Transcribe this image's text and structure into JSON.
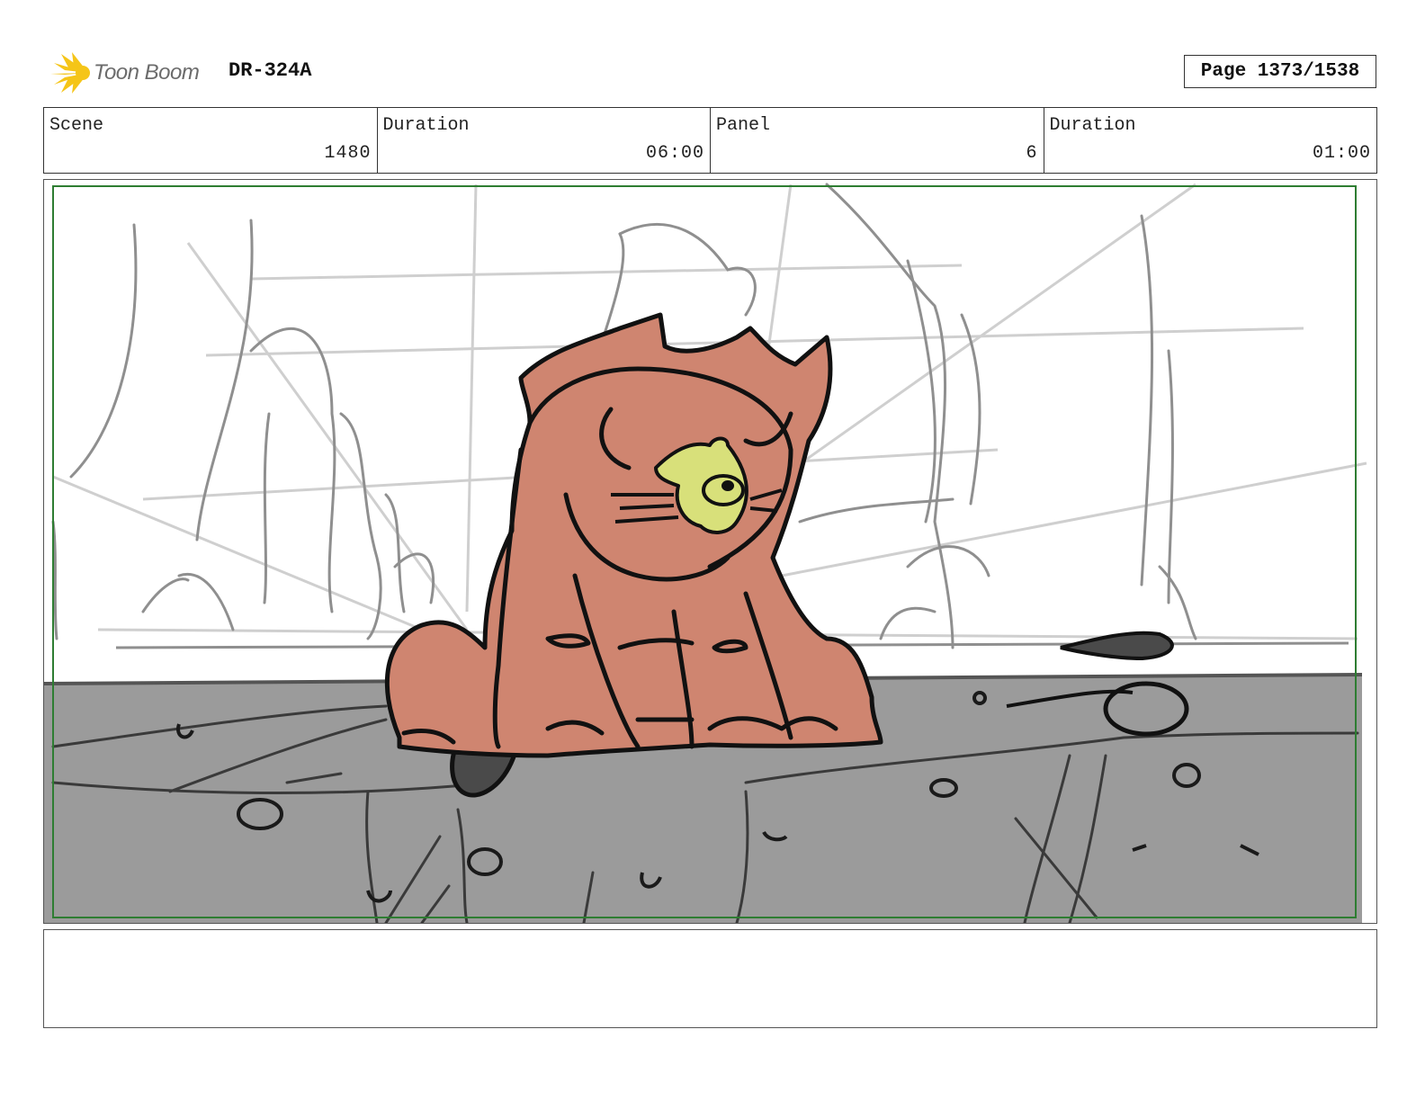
{
  "header": {
    "brand": "Toon Boom",
    "doc_id": "DR-324A",
    "page_label": "Page 1373/1538"
  },
  "info": {
    "scene_label": "Scene",
    "scene_value": "1480",
    "scene_duration_label": "Duration",
    "scene_duration_value": "06:00",
    "panel_label": "Panel",
    "panel_value": "6",
    "panel_duration_label": "Duration",
    "panel_duration_value": "01:00"
  },
  "colors": {
    "safe_frame": "#2e7d32",
    "ground": "#9b9b9b",
    "creature": "#cf8570",
    "bird": "#d8e07a",
    "logo": "#f5c518"
  },
  "notes": ""
}
